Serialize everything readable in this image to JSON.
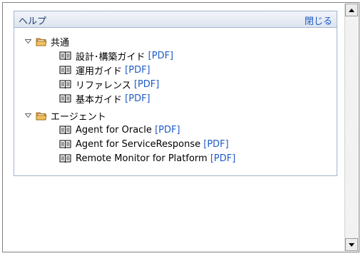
{
  "panel": {
    "title": "ヘルプ",
    "close_label": "閉じる"
  },
  "groups": [
    {
      "title": "共通",
      "items": [
        {
          "name": "設計･構築ガイド",
          "link": "[PDF]"
        },
        {
          "name": "運用ガイド",
          "link": "[PDF]"
        },
        {
          "name": "リファレンス",
          "link": "[PDF]"
        },
        {
          "name": "基本ガイド",
          "link": "[PDF]"
        }
      ]
    },
    {
      "title": "エージェント",
      "items": [
        {
          "name": "Agent for Oracle",
          "link": "[PDF]"
        },
        {
          "name": "Agent for ServiceResponse",
          "link": "[PDF]"
        },
        {
          "name": "Remote Monitor for Platform",
          "link": "[PDF]"
        }
      ]
    }
  ],
  "colors": {
    "link": "#1e5bc6",
    "panel_border": "#a3b3cc",
    "header_text": "#1f3e73"
  },
  "icons": {
    "group_toggle": "triangle-down-icon",
    "group_icon": "folder-icon",
    "item_icon": "book-icon",
    "scroll_up": "arrow-up-icon",
    "scroll_down": "arrow-down-icon"
  }
}
